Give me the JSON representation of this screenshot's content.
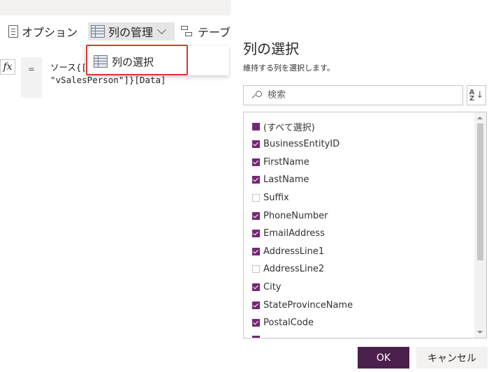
{
  "ribbon": {
    "options_label": "オプション",
    "manage_columns_label": "列の管理",
    "transform_table_label": "テーブルの変換"
  },
  "formula_bar": {
    "fx": "fx",
    "equals": "=",
    "line1": "ソース{[Schema = \"Sales\", Item =",
    "line2": "\"vSalesPerson\"]}[Data]"
  },
  "menu": {
    "choose_columns_label": "列の選択"
  },
  "dialog": {
    "title": "列の選択",
    "subtitle": "維持する列を選択します。",
    "search_placeholder": "検索",
    "sort_top": "A",
    "sort_bottom": "Z",
    "columns": [
      {
        "label": "(すべて選択)",
        "state": "indeterminate"
      },
      {
        "label": "BusinessEntityID",
        "state": "checked"
      },
      {
        "label": "FirstName",
        "state": "checked"
      },
      {
        "label": "LastName",
        "state": "checked"
      },
      {
        "label": "Suffix",
        "state": "unchecked"
      },
      {
        "label": "PhoneNumber",
        "state": "checked"
      },
      {
        "label": "EmailAddress",
        "state": "checked"
      },
      {
        "label": "AddressLine1",
        "state": "checked"
      },
      {
        "label": "AddressLine2",
        "state": "unchecked"
      },
      {
        "label": "City",
        "state": "checked"
      },
      {
        "label": "StateProvinceName",
        "state": "checked"
      },
      {
        "label": "PostalCode",
        "state": "checked"
      }
    ],
    "ok_label": "OK",
    "cancel_label": "キャンセル"
  },
  "colors": {
    "accent": "#742774",
    "ok_button": "#4b1f4b",
    "highlight_border": "#e03535"
  }
}
